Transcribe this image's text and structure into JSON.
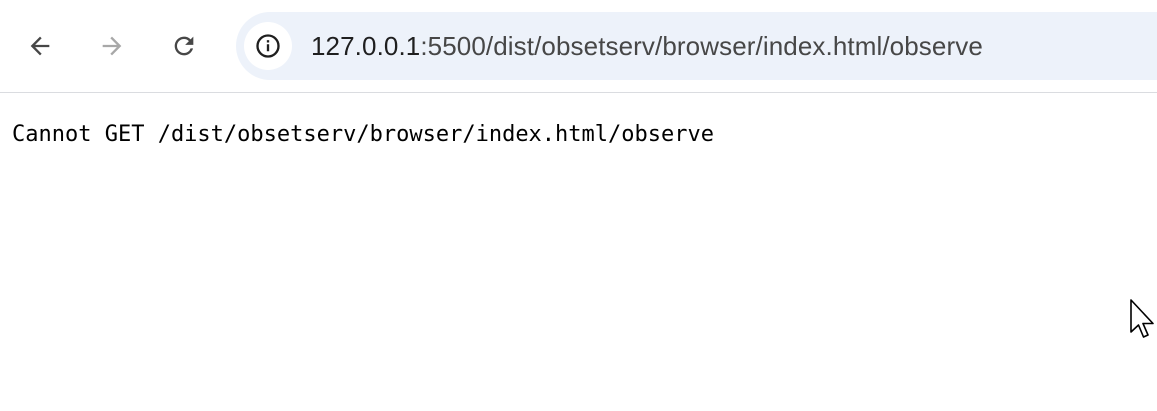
{
  "browser": {
    "toolbar": {
      "back_icon": "arrow-left-icon",
      "forward_icon": "arrow-right-icon",
      "reload_icon": "reload-icon",
      "site_info_icon": "info-icon"
    },
    "address_bar": {
      "host": "127.0.0.1",
      "path": ":5500/dist/obsetserv/browser/index.html/observe"
    }
  },
  "page": {
    "message": "Cannot GET /dist/obsetserv/browser/index.html/observe"
  },
  "colors": {
    "omnibox_bg": "#edf2fa",
    "icon_active": "#474747",
    "icon_disabled": "#a8a8a8"
  }
}
